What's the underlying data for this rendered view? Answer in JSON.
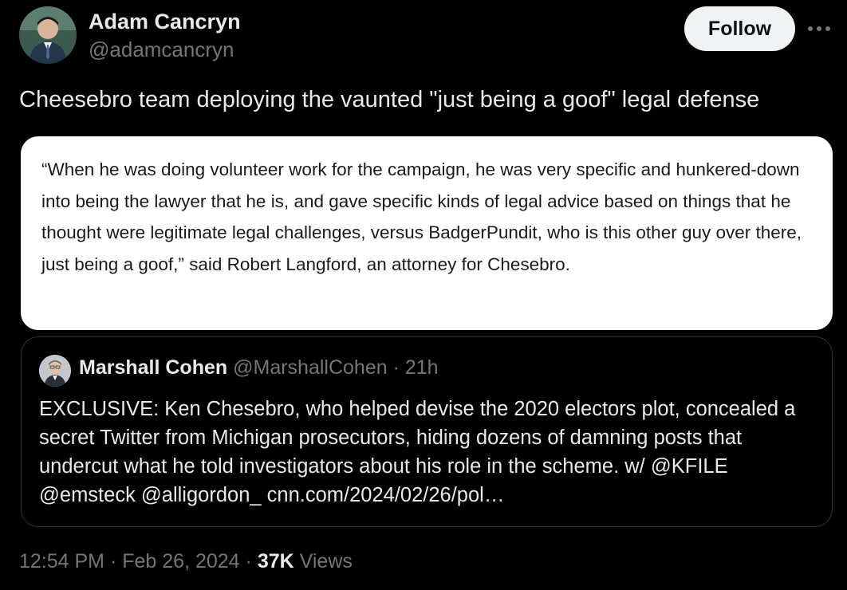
{
  "author": {
    "name": "Adam Cancryn",
    "handle": "@adamcancryn"
  },
  "follow_label": "Follow",
  "tweet": {
    "text": "Cheesebro team deploying the vaunted \"just being a goof\" legal defense"
  },
  "media_quote": "“When he was doing volunteer work for the campaign, he was very specific and hunkered-down into being the lawyer that he is, and gave specific kinds of legal advice based on things that he thought were legitimate legal challenges, versus BadgerPundit, who is this other guy over there, just being a goof,” said Robert Langford, an attorney for Chesebro.",
  "quoted_tweet": {
    "name": "Marshall Cohen",
    "handle": "@MarshallCohen",
    "separator": "·",
    "time": "21h",
    "text": "EXCLUSIVE: Ken Chesebro, who helped devise the 2020 electors plot, concealed a secret Twitter from Michigan prosecutors, hiding dozens of damning posts that undercut what he told investigators about his role in the scheme. w/ @KFILE @emsteck @alligordon_ cnn.com/2024/02/26/pol…"
  },
  "meta": {
    "time": "12:54 PM",
    "sep1": "·",
    "date": "Feb 26, 2024",
    "sep2": "·",
    "views_count": "37K",
    "views_label": "Views"
  },
  "icons": {
    "avatar": "profile-photo",
    "more": "more-horizontal-icon",
    "quoted_avatar": "profile-photo"
  },
  "colors": {
    "background": "#000000",
    "primary_text": "#e7e9ea",
    "secondary_text": "#71767b",
    "border": "#2f3336",
    "follow_bg": "#eff3f4"
  }
}
